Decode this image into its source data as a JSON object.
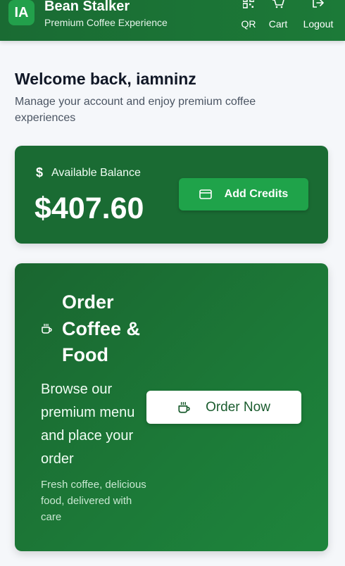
{
  "header": {
    "avatar_initials": "IA",
    "brand_title": "Bean Stalker",
    "brand_subtitle": "Premium Coffee Experience",
    "nav": {
      "qr_label": "QR",
      "cart_label": "Cart",
      "logout_label": "Logout"
    }
  },
  "welcome": {
    "title": "Welcome back, iamninz",
    "subtitle": "Manage your account and enjoy premium coffee experiences"
  },
  "balance": {
    "currency_symbol": "$",
    "label": "Available Balance",
    "amount": "$407.60",
    "add_credits_label": "Add Credits"
  },
  "order": {
    "title": "Order Coffee & Food",
    "description": "Browse our premium menu and place your order",
    "note": "Fresh coffee, delicious food, delivered with care",
    "order_now_label": "Order Now"
  },
  "colors": {
    "primary_green": "#1a6b33",
    "accent_green": "#1fa34a",
    "page_background": "#f5f7fa"
  },
  "icons": {
    "nav_qr": "qr-code-icon",
    "nav_cart": "cart-icon",
    "nav_logout": "logout-icon",
    "balance": "dollar-icon",
    "add_credits": "credit-card-icon",
    "order": "coffee-cup-icon"
  }
}
